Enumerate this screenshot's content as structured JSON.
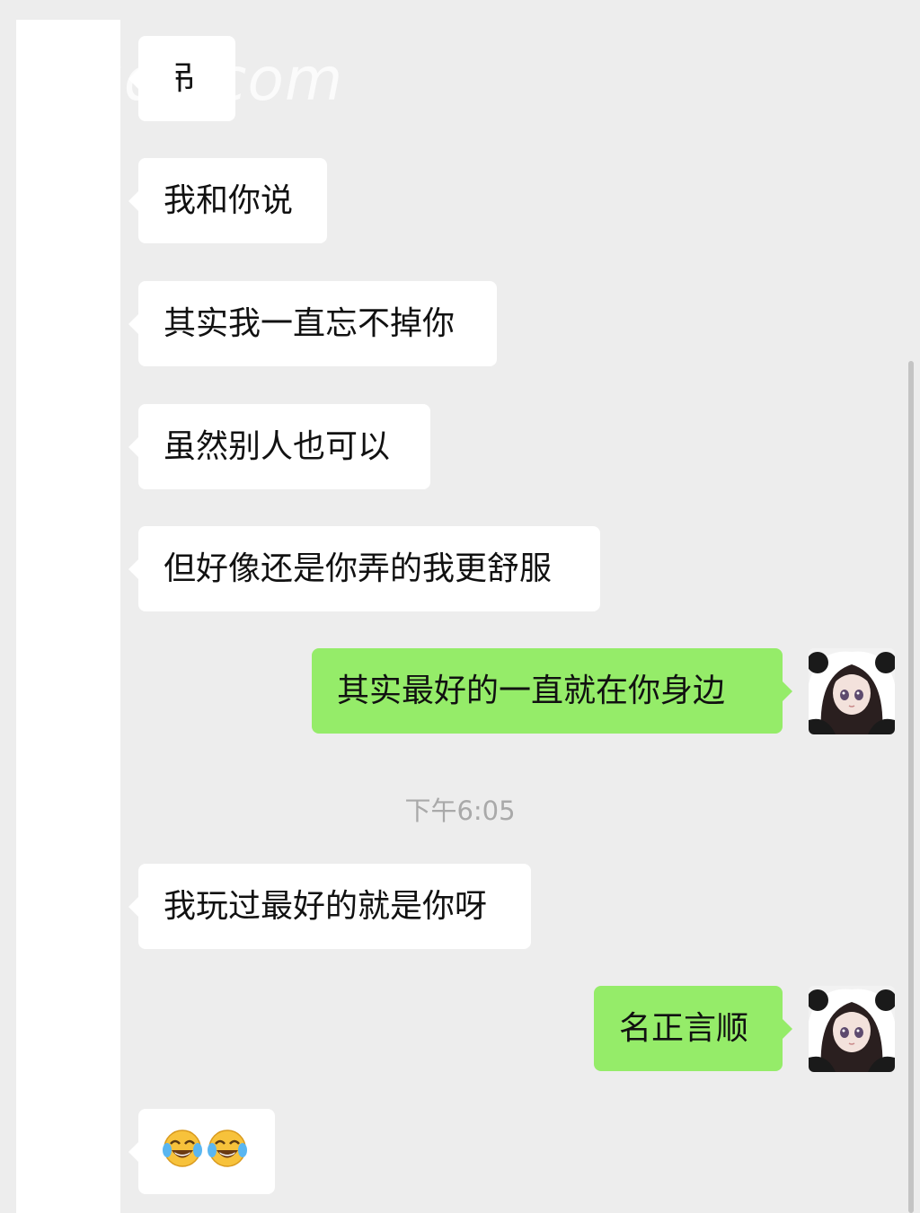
{
  "watermark": "gds.com",
  "messages": [
    {
      "side": "in",
      "text": "吊"
    },
    {
      "side": "in",
      "text": "我和你说"
    },
    {
      "side": "in",
      "text": "其实我一直忘不掉你"
    },
    {
      "side": "in",
      "text": "虽然别人也可以"
    },
    {
      "side": "in",
      "text": "但好像还是你弄的我更舒服"
    },
    {
      "side": "out",
      "text": "其实最好的一直就在你身边"
    },
    {
      "side": "in",
      "text": "我玩过最好的就是你呀"
    },
    {
      "side": "out",
      "text": "名正言顺"
    },
    {
      "side": "in",
      "emoji": [
        "😂",
        "😂"
      ],
      "icon": "tears-of-joy-emoji"
    }
  ],
  "timestamp": "下午6:05",
  "colors": {
    "background": "#ededed",
    "incoming_bubble": "#ffffff",
    "outgoing_bubble": "#95ec69",
    "timestamp_text": "#a9a9a9"
  },
  "icons": {
    "avatar": "anime-girl-panda-hood-avatar"
  }
}
